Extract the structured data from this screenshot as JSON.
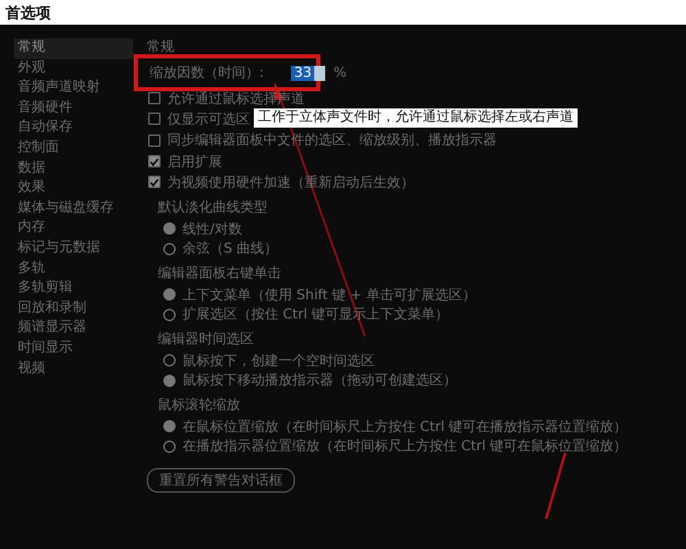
{
  "window": {
    "title": "首选项"
  },
  "sidebar": {
    "items": [
      {
        "label": "常规",
        "selected": true
      },
      {
        "label": "外观",
        "selected": false
      },
      {
        "label": "音频声道映射",
        "selected": false
      },
      {
        "label": "音频硬件",
        "selected": false
      },
      {
        "label": "自动保存",
        "selected": false
      },
      {
        "label": "控制面",
        "selected": false
      },
      {
        "label": "数据",
        "selected": false
      },
      {
        "label": "效果",
        "selected": false
      },
      {
        "label": "媒体与磁盘缓存",
        "selected": false
      },
      {
        "label": "内存",
        "selected": false
      },
      {
        "label": "标记与元数据",
        "selected": false
      },
      {
        "label": "多轨",
        "selected": false
      },
      {
        "label": "多轨剪辑",
        "selected": false
      },
      {
        "label": "回放和录制",
        "selected": false
      },
      {
        "label": "频谱显示器",
        "selected": false
      },
      {
        "label": "时间显示",
        "selected": false
      },
      {
        "label": "视频",
        "selected": false
      }
    ]
  },
  "general": {
    "heading": "常规",
    "zoom": {
      "label": "缩放因数（时间）:",
      "value": "33",
      "unit": "%"
    },
    "checkboxes": [
      {
        "label": "允许通过鼠标选择声道",
        "checked": false
      },
      {
        "label": "仅显示可选区",
        "checked": false
      },
      {
        "label": "同步编辑器面板中文件的选区、缩放级别、播放指示器",
        "checked": false
      },
      {
        "label": "启用扩展",
        "checked": true
      },
      {
        "label": "为视频使用硬件加速（重新启动后生效）",
        "checked": true
      }
    ],
    "groups": [
      {
        "heading": "默认淡化曲线类型",
        "options": [
          {
            "label": "线性/对数",
            "selected": true
          },
          {
            "label": "余弦（S 曲线）",
            "selected": false
          }
        ]
      },
      {
        "heading": "编辑器面板右键单击",
        "options": [
          {
            "label": "上下文菜单（使用 Shift 键 + 单击可扩展选区）",
            "selected": true
          },
          {
            "label": "扩展选区（按住 Ctrl 键可显示上下文菜单）",
            "selected": false
          }
        ]
      },
      {
        "heading": "编辑器时间选区",
        "options": [
          {
            "label": "鼠标按下，创建一个空时间选区",
            "selected": false
          },
          {
            "label": "鼠标按下移动播放指示器（拖动可创建选区）",
            "selected": true
          }
        ]
      },
      {
        "heading": "鼠标滚轮缩放",
        "options": [
          {
            "label": "在鼠标位置缩放（在时间标尺上方按住 Ctrl 键可在播放指示器位置缩放）",
            "selected": true
          },
          {
            "label": "在播放指示器位置缩放（在时间标尺上方按住 Ctrl 键可在鼠标位置缩放）",
            "selected": false
          }
        ]
      }
    ],
    "reset_button": "重置所有警告对话框"
  },
  "tooltip": "工作于立体声文件时，允许通过鼠标选择左或右声道"
}
